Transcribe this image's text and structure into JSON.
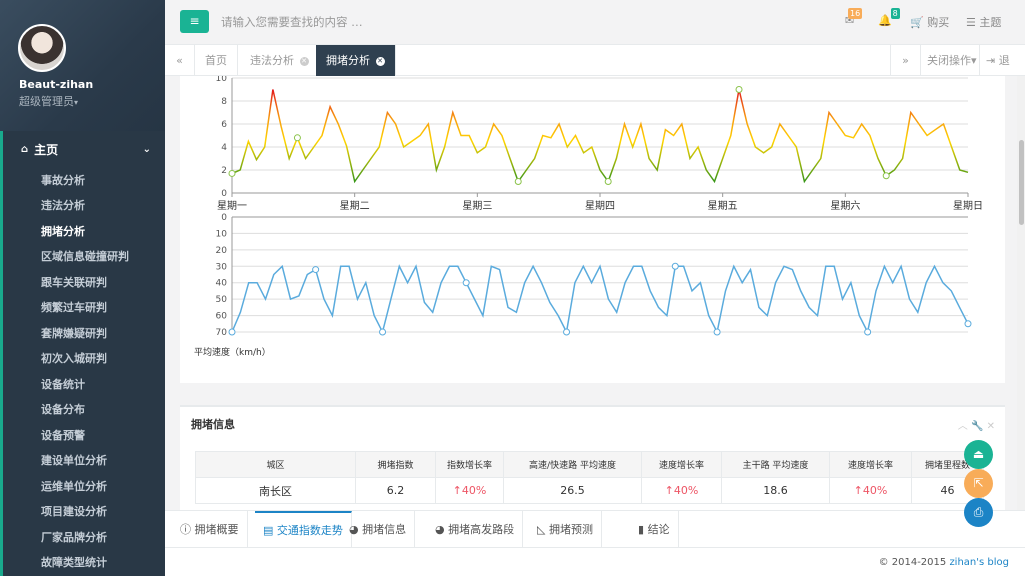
{
  "user": {
    "name": "Beaut-zihan",
    "role": "超级管理员"
  },
  "nav": {
    "home": "主页",
    "items": [
      "事故分析",
      "违法分析",
      "拥堵分析",
      "区域信息碰撞研判",
      "跟车关联研判",
      "频繁过车研判",
      "套牌嫌疑研判",
      "初次入城研判",
      "设备统计",
      "设备分布",
      "设备预警",
      "建设单位分析",
      "运维单位分析",
      "项目建设分析",
      "厂家品牌分析",
      "故障类型统计"
    ],
    "active_index": 2
  },
  "topbar": {
    "search_placeholder": "请输入您需要查找的内容 …",
    "mail_count": "16",
    "bell_count": "8",
    "buy": "购买",
    "theme": "主题"
  },
  "tabs": {
    "items": [
      "首页",
      "违法分析",
      "拥堵分析"
    ],
    "active_index": 2,
    "close_ops": "关闭操作",
    "logout": "退出"
  },
  "chart_data": [
    {
      "type": "line",
      "x": [
        "星期一",
        "星期二",
        "星期三",
        "星期四",
        "星期五",
        "星期六",
        "星期日"
      ],
      "ylim": [
        0,
        10
      ],
      "yticks": [
        0,
        2,
        4,
        6,
        8,
        10
      ],
      "values": [
        1.7,
        2,
        4.5,
        2.9,
        4,
        9,
        5.8,
        3,
        4.8,
        3,
        4,
        5,
        7.5,
        6,
        4.1,
        1,
        2,
        3,
        4,
        7,
        6,
        4,
        4.5,
        5,
        6,
        2,
        4,
        7,
        5,
        5,
        3.5,
        4,
        6,
        5,
        3,
        1,
        2,
        3,
        5,
        4.8,
        6,
        4,
        5,
        3.5,
        4,
        2,
        1,
        3,
        6,
        4,
        6,
        3,
        2,
        5.5,
        5,
        6,
        3,
        4,
        2,
        1,
        3,
        5,
        9,
        6,
        4,
        3.5,
        4,
        6,
        5,
        4,
        1,
        2,
        3,
        7,
        6,
        5,
        4.8,
        6,
        5,
        3,
        1.5,
        2,
        3,
        7,
        6,
        5,
        5.5,
        6,
        4,
        2,
        1.8
      ],
      "colors": {
        "high": "#e31a1c",
        "mid": "#ffd400",
        "low": "#00851e"
      }
    },
    {
      "type": "line",
      "ylabel": "平均速度（km/h）",
      "ylim": [
        0,
        70
      ],
      "inverted": true,
      "yticks": [
        0,
        10,
        20,
        30,
        40,
        50,
        60,
        70
      ],
      "values": [
        70,
        58,
        40,
        40,
        50,
        35,
        30,
        50,
        48,
        35,
        32,
        50,
        60,
        30,
        30,
        50,
        40,
        60,
        70,
        50,
        30,
        40,
        30,
        52,
        58,
        40,
        30,
        30,
        40,
        50,
        60,
        30,
        32,
        55,
        58,
        40,
        30,
        40,
        52,
        60,
        70,
        40,
        30,
        40,
        30,
        50,
        58,
        40,
        30,
        30,
        45,
        55,
        60,
        30,
        30,
        45,
        40,
        60,
        70,
        45,
        30,
        40,
        32,
        55,
        60,
        40,
        30,
        32,
        45,
        55,
        60,
        30,
        30,
        50,
        40,
        60,
        70,
        45,
        30,
        40,
        30,
        50,
        58,
        40,
        30,
        40,
        45,
        55,
        65
      ],
      "color": "#5aabdd"
    }
  ],
  "panel": {
    "title": "拥堵信息",
    "columns": [
      "城区",
      "拥堵指数",
      "指数增长率",
      "高速/快速路 平均速度",
      "速度增长率",
      "主干路 平均速度",
      "速度增长率",
      "拥堵里程数"
    ],
    "rows": [
      [
        "南长区",
        "6.2",
        "↑40%",
        "26.5",
        "↑40%",
        "18.6",
        "↑40%",
        "46"
      ]
    ]
  },
  "bottom_tabs": {
    "items": [
      "拥堵概要",
      "交通指数走势",
      "拥堵信息",
      "拥堵高发路段",
      "拥堵预测",
      "结论"
    ],
    "active_index": 1
  },
  "footer": {
    "copyright": "© 2014-2015",
    "brand": "zihan's blog"
  },
  "fab_colors": [
    "#1ab394",
    "#f8ac59",
    "#1c84c6"
  ]
}
